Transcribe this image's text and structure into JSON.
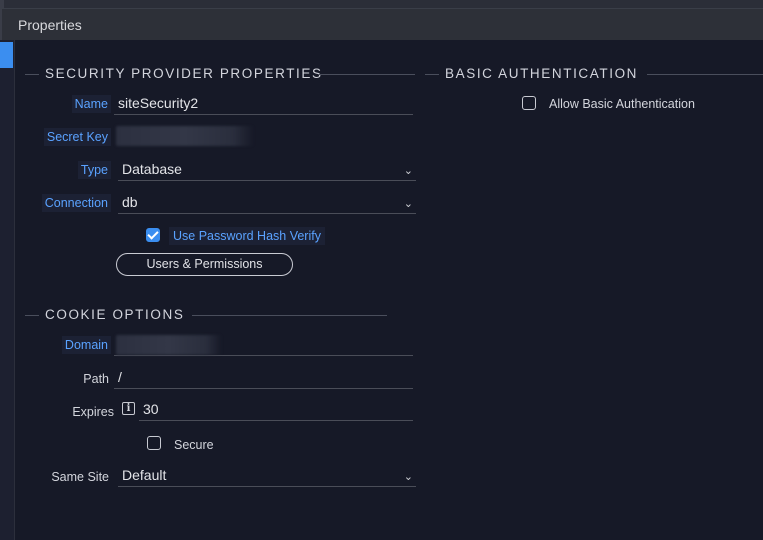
{
  "window": {
    "title": "Properties"
  },
  "security_provider": {
    "heading": "SECURITY PROVIDER PROPERTIES",
    "name": {
      "label": "Name",
      "value": "siteSecurity2"
    },
    "secret_key": {
      "label": "Secret Key",
      "value": ""
    },
    "type": {
      "label": "Type",
      "value": "Database"
    },
    "connection": {
      "label": "Connection",
      "value": "db"
    },
    "use_password_hash": {
      "label": "Use Password Hash Verify",
      "checked": true
    },
    "users_button": "Users & Permissions"
  },
  "basic_auth": {
    "heading": "BASIC AUTHENTICATION",
    "allow": {
      "label": "Allow Basic Authentication",
      "checked": false
    }
  },
  "cookie": {
    "heading": "COOKIE OPTIONS",
    "domain": {
      "label": "Domain",
      "value": ""
    },
    "path": {
      "label": "Path",
      "value": "/"
    },
    "expires": {
      "label": "Expires",
      "value": "30",
      "icon": "info-icon"
    },
    "secure": {
      "label": "Secure",
      "checked": false
    },
    "same_site": {
      "label": "Same Site",
      "value": "Default"
    }
  },
  "colors": {
    "accent": "#3b8ef0",
    "label_highlight": "#5aa2ff",
    "background": "#161927"
  }
}
